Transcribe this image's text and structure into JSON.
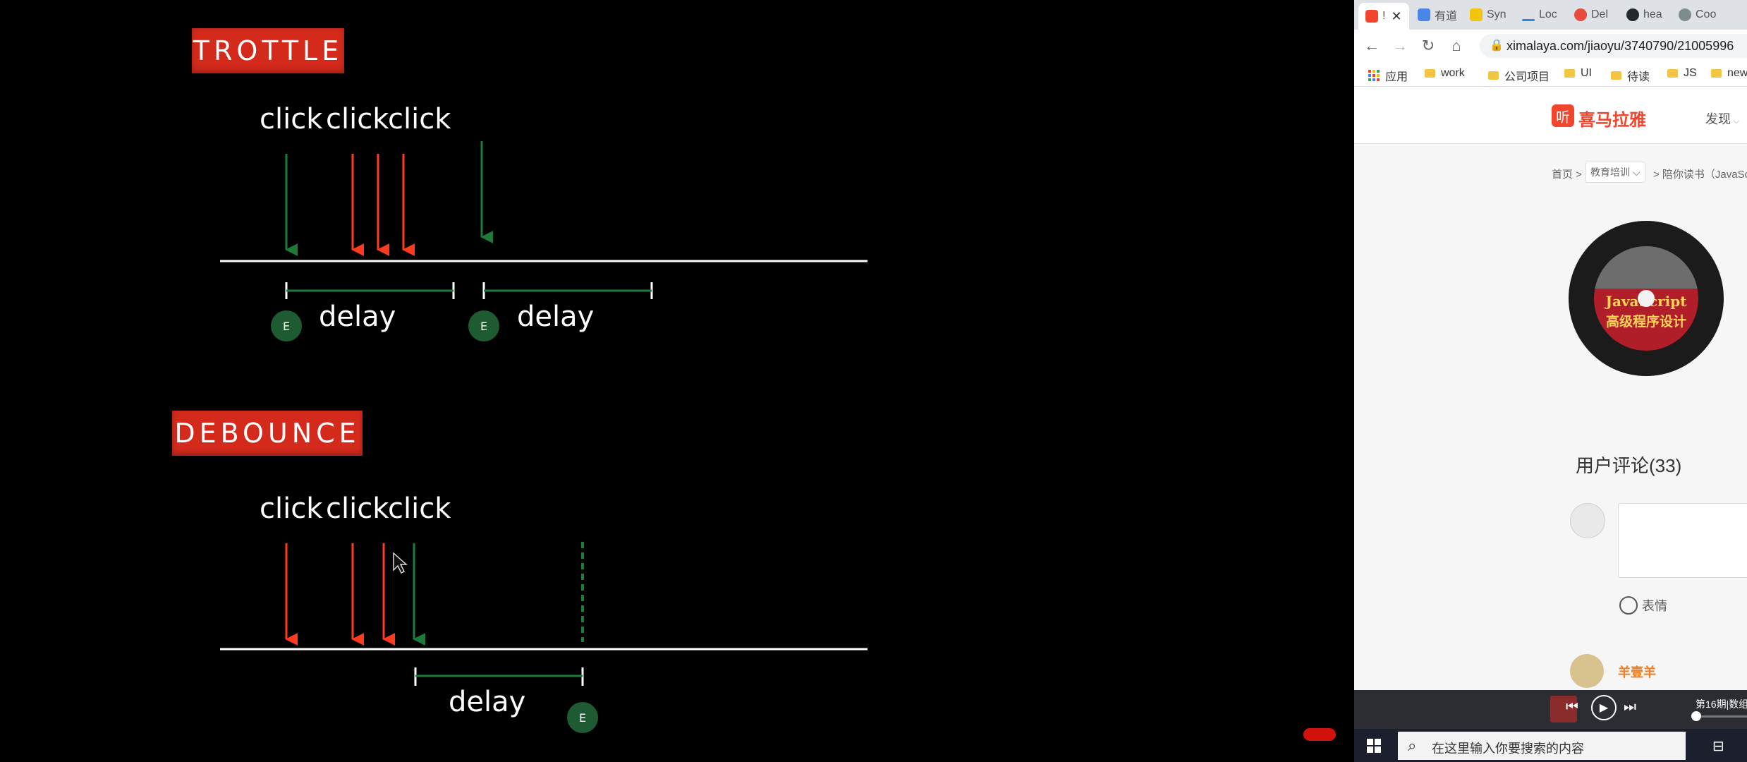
{
  "slide": {
    "throttle_title": "TROTTLE",
    "debounce_title": "DEBOUNCE",
    "click_label": "click",
    "delay_label": "delay",
    "event_label": "E",
    "colors": {
      "title_bg": "#d42a1c",
      "red_arrow": "#ff3b1f",
      "green_arrow": "#1e5b32",
      "event_dot": "#1e5b32"
    }
  },
  "browser": {
    "tabs": [
      {
        "label": "!",
        "active": true,
        "favicon_color": "#f2452d"
      },
      {
        "label": "有道",
        "favicon_color": "#4a86e8"
      },
      {
        "label": "Syn",
        "favicon_color": "#f1c40f"
      },
      {
        "label": "Loc",
        "favicon_color": "#2e86de"
      },
      {
        "label": "Del",
        "favicon_color": "#e74c3c"
      },
      {
        "label": "hea",
        "favicon_color": "#24292e"
      },
      {
        "label": "Coo",
        "favicon_color": "#7f8c8d"
      }
    ],
    "url": "ximalaya.com/jiaoyu/3740790/21005996",
    "bookmarks": [
      "应用",
      "work",
      "公司项目",
      "UI",
      "待读",
      "JS",
      "new"
    ],
    "site": {
      "logo_char": "听",
      "logo_text": "喜马拉雅",
      "nav_discover": "发现",
      "breadcrumb_home": "首页 >",
      "breadcrumb_category": "教育培训",
      "breadcrumb_rest": "> 陪你读书（JavaSc",
      "cover_title": "JavaScript",
      "cover_subtitle": "高级程序设计",
      "comments_heading": "用户评论(33)",
      "emoji_label": "表情",
      "commenter_name": "羊壹羊"
    },
    "player": {
      "title": "第16期|数组"
    },
    "taskbar": {
      "search_placeholder": "在这里输入你要搜索的内容"
    }
  }
}
